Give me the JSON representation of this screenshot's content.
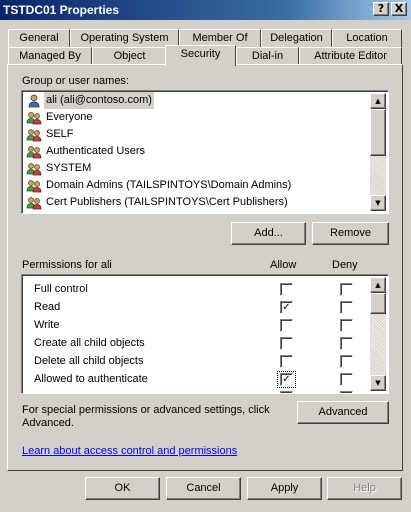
{
  "window": {
    "title": "TSTDC01 Properties",
    "help_glyph": "?",
    "close_glyph": "X"
  },
  "tabs": {
    "row1": [
      "General",
      "Operating System",
      "Member Of",
      "Delegation",
      "Location"
    ],
    "row2": [
      "Managed By",
      "Object",
      "Security",
      "Dial-in",
      "Attribute Editor"
    ],
    "active": "Security"
  },
  "groups": {
    "label": "Group or user names:",
    "items": [
      {
        "name": "ali (ali@contoso.com)",
        "icon": "user-icon",
        "selected": true
      },
      {
        "name": "Everyone",
        "icon": "users-group-icon"
      },
      {
        "name": "SELF",
        "icon": "users-group-icon"
      },
      {
        "name": "Authenticated Users",
        "icon": "users-group-icon"
      },
      {
        "name": "SYSTEM",
        "icon": "users-group-icon"
      },
      {
        "name": "Domain Admins (TAILSPINTOYS\\Domain Admins)",
        "icon": "users-group-icon"
      },
      {
        "name": "Cert Publishers (TAILSPINTOYS\\Cert Publishers)",
        "icon": "users-group-icon"
      }
    ],
    "add_label": "Add...",
    "remove_label": "Remove"
  },
  "permissions": {
    "label": "Permissions for ali",
    "allow_header": "Allow",
    "deny_header": "Deny",
    "rows": [
      {
        "name": "Full control",
        "allow": false,
        "deny": false
      },
      {
        "name": "Read",
        "allow": true,
        "deny": false
      },
      {
        "name": "Write",
        "allow": false,
        "deny": false
      },
      {
        "name": "Create all child objects",
        "allow": false,
        "deny": false
      },
      {
        "name": "Delete all child objects",
        "allow": false,
        "deny": false
      },
      {
        "name": "Allowed to authenticate",
        "allow": true,
        "deny": false
      }
    ]
  },
  "advanced": {
    "text_line1": "For special permissions or advanced settings, click",
    "text_line2": "Advanced.",
    "button_label": "Advanced"
  },
  "learn_link": "Learn about access control and permissions",
  "footer": {
    "ok": "OK",
    "cancel": "Cancel",
    "apply": "Apply",
    "help": "Help"
  },
  "scroll": {
    "up_glyph": "▲",
    "down_glyph": "▼"
  },
  "colors": {
    "title_start": "#0a246a",
    "title_end": "#a6caf0",
    "face": "#d4d0c8",
    "link": "#0000ff"
  }
}
